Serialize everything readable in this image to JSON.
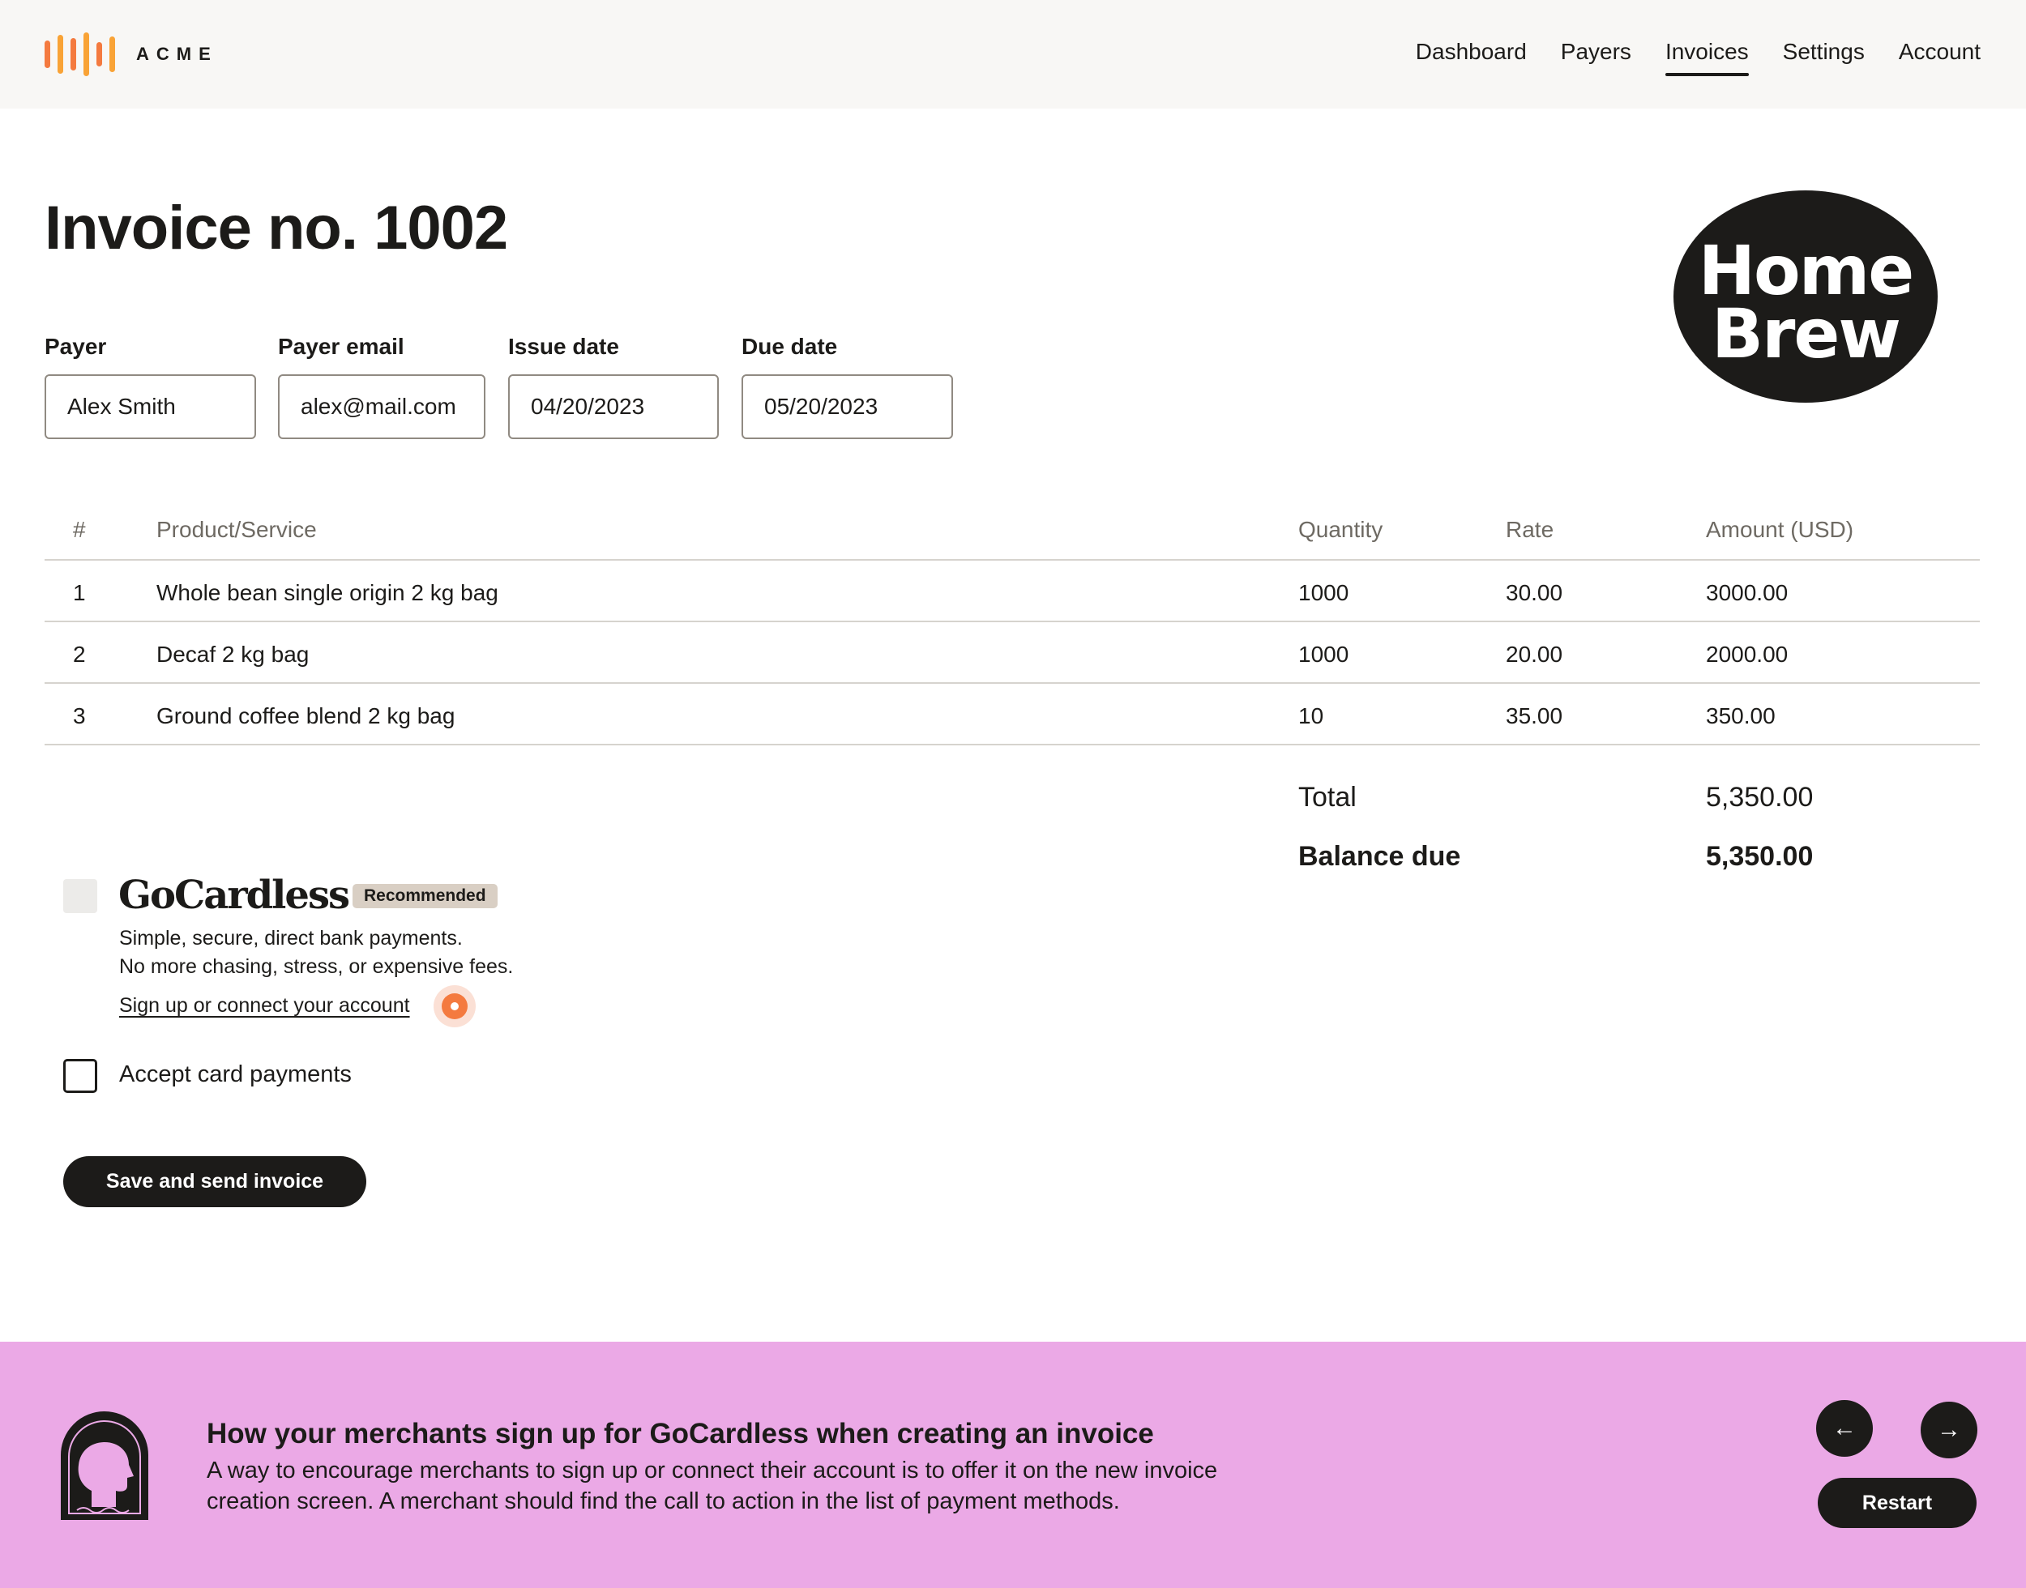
{
  "header": {
    "logo_text": "ACME",
    "logo_colors": [
      "#f47a3f",
      "#f9a336",
      "#f47a3f",
      "#f9a336",
      "#f47a3f",
      "#f9a336"
    ],
    "nav": [
      {
        "label": "Dashboard",
        "active": false
      },
      {
        "label": "Payers",
        "active": false
      },
      {
        "label": "Invoices",
        "active": true
      },
      {
        "label": "Settings",
        "active": false
      },
      {
        "label": "Account",
        "active": false
      }
    ]
  },
  "invoice": {
    "title": "Invoice no. 1002",
    "brand": {
      "line1": "Home",
      "line2": "Brew"
    },
    "fields": {
      "payer": {
        "label": "Payer",
        "value": "Alex Smith"
      },
      "payer_email": {
        "label": "Payer email",
        "value": "alex@mail.com"
      },
      "issue_date": {
        "label": "Issue date",
        "value": "04/20/2023"
      },
      "due_date": {
        "label": "Due date",
        "value": "05/20/2023"
      }
    },
    "table": {
      "headers": {
        "num": "#",
        "product": "Product/Service",
        "quantity": "Quantity",
        "rate": "Rate",
        "amount": "Amount (USD)"
      },
      "rows": [
        {
          "num": "1",
          "product": "Whole bean single origin 2 kg bag",
          "quantity": "1000",
          "rate": "30.00",
          "amount": "3000.00"
        },
        {
          "num": "2",
          "product": "Decaf 2 kg bag",
          "quantity": "1000",
          "rate": "20.00",
          "amount": "2000.00"
        },
        {
          "num": "3",
          "product": "Ground coffee blend 2 kg bag",
          "quantity": "10",
          "rate": "35.00",
          "amount": "350.00"
        }
      ]
    },
    "totals": {
      "total_label": "Total",
      "total_value": "5,350.00",
      "balance_label": "Balance due",
      "balance_value": "5,350.00"
    }
  },
  "payment_methods": {
    "gocardless": {
      "name": "GoCardless",
      "badge": "Recommended",
      "desc_line1": "Simple, secure, direct bank payments.",
      "desc_line2": "No more chasing, stress, or expensive fees.",
      "link": "Sign up or connect your account",
      "checked": false
    },
    "card": {
      "label": "Accept card payments",
      "checked": false
    }
  },
  "actions": {
    "save_send": "Save and send invoice"
  },
  "banner": {
    "title": "How your merchants sign up for GoCardless when creating an invoice",
    "text": "A way to encourage merchants to sign up or connect their account is to offer it on the new invoice creation screen. A merchant should find the call to action in the list of payment methods.",
    "prev_icon": "←",
    "next_icon": "→",
    "restart": "Restart",
    "background": "#eba9e6"
  }
}
